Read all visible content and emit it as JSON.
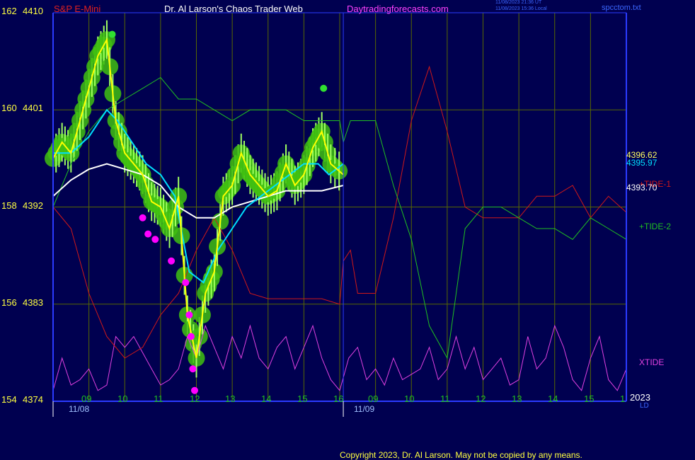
{
  "header": {
    "instrument": "S&P E-Mini",
    "site": "Dr. Al Larson's Chaos Trader Web",
    "url": "Daytradingforecasts.com",
    "stamp_utc": "11/08/2023 21:36 UT",
    "stamp_local": "11/08/2023 15:36 Local",
    "file": "spcctom.txt"
  },
  "footer": {
    "copyright": "Copyright 2023, Dr. Al Larson. May not be copied by any means."
  },
  "colors": {
    "background": "#000050",
    "grid": "#586800",
    "frame": "#2b3bff",
    "price": "#ffff00",
    "fast_ma": "#00e0ff",
    "slow_ma": "#ffffff",
    "tide1": "#d01818",
    "tide2": "#20c020",
    "xtide": "#e040e0",
    "bubbles": "#40c010",
    "bar": "#a0ff60",
    "magenta_dots": "#ff00ff"
  },
  "chart_data": {
    "type": "line",
    "title": "S&P E-Mini",
    "y_price_ticks": [
      4374,
      4383,
      4392,
      4401,
      4410
    ],
    "y_left_ticks": [
      154,
      156,
      158,
      160,
      162
    ],
    "y_range": [
      4374,
      4410
    ],
    "x_hour_ticks": [
      "09",
      "10",
      "11",
      "12",
      "13",
      "14",
      "15",
      "16",
      "09",
      "10",
      "11",
      "12",
      "13",
      "14",
      "15",
      "1"
    ],
    "dates": [
      "11/08",
      "11/09"
    ],
    "x_range": [
      0,
      16
    ],
    "grid": true,
    "year_label": "2023",
    "bottom_right_tag": "LD",
    "labels": {
      "last_price": "4396.62",
      "fast_ma_value": "4395.97",
      "slow_ma_value": "4393.70",
      "tide1": "+TIDE-1",
      "tide2": "+TIDE-2",
      "xtide": "XTIDE"
    },
    "series": [
      {
        "name": "price",
        "x": [
          0,
          0.25,
          0.5,
          0.75,
          1,
          1.25,
          1.5,
          1.75,
          2,
          2.25,
          2.5,
          2.75,
          3,
          3.25,
          3.5,
          3.75,
          4,
          4.25,
          4.5,
          4.75,
          5,
          5.25,
          5.5,
          5.75,
          6,
          6.25,
          6.5,
          6.75,
          7,
          7.25,
          7.5,
          7.75,
          8.1
        ],
        "y": [
          4396.5,
          4398,
          4397,
          4400,
          4403,
          4406,
          4407.5,
          4400,
          4397,
          4396,
          4395,
          4392.5,
          4392,
          4390,
          4393,
          4382,
          4378,
          4384,
          4386,
          4393,
          4394,
          4397,
          4395,
          4394,
          4393,
          4393.5,
          4396,
          4394,
          4395,
          4397.5,
          4399,
          4396,
          4395
        ]
      },
      {
        "name": "fast_ma",
        "x": [
          0,
          0.5,
          1,
          1.5,
          1.8,
          2.2,
          2.6,
          3,
          3.4,
          3.8,
          4.2,
          4.6,
          5,
          5.4,
          5.8,
          6.2,
          6.6,
          7,
          7.4,
          7.7,
          8.1
        ],
        "y": [
          4397,
          4397,
          4398.5,
          4401,
          4400,
          4398,
          4396,
          4395,
          4393,
          4386,
          4385,
          4388,
          4390,
          4392,
          4393,
          4394,
          4395,
          4396,
          4396,
          4395,
          4396
        ]
      },
      {
        "name": "slow_ma",
        "x": [
          0,
          0.5,
          1,
          1.5,
          2,
          2.5,
          3,
          3.5,
          4,
          4.5,
          5,
          5.5,
          6,
          6.5,
          7,
          7.5,
          8.1
        ],
        "y": [
          4393,
          4394.5,
          4395.5,
          4396,
          4395.5,
          4395,
          4394,
          4392,
          4391,
          4391,
          4392,
          4392.5,
          4393,
          4393.5,
          4393.5,
          4393.5,
          4394
        ]
      },
      {
        "name": "TIDE-1",
        "x": [
          0,
          0.5,
          1,
          1.5,
          2,
          2.5,
          3,
          3.5,
          4,
          4.5,
          5,
          5.5,
          6,
          6.5,
          7,
          7.5,
          8,
          8.1,
          8.3,
          8.5,
          9,
          9.5,
          10,
          10.5,
          11,
          11.5,
          12,
          12.5,
          13,
          13.5,
          14,
          14.5,
          15,
          15.5,
          16
        ],
        "y": [
          4392,
          4390,
          4384,
          4380,
          4378,
          4379,
          4382,
          4384,
          4388,
          4391,
          4388,
          4384,
          4383.5,
          4383.5,
          4383.5,
          4383.5,
          4383,
          4387,
          4388,
          4384,
          4384,
          4391,
          4400,
          4405,
          4399,
          4392,
          4391,
          4391,
          4391,
          4393,
          4393,
          4394,
          4391,
          4393,
          4391.5
        ]
      },
      {
        "name": "TIDE-2",
        "x": [
          0,
          0.5,
          1,
          1.5,
          2,
          2.5,
          3,
          3.5,
          4,
          4.5,
          5,
          5.5,
          6,
          6.5,
          7,
          7.5,
          8,
          8.1,
          8.3,
          8.5,
          9,
          9.5,
          10,
          10.5,
          11,
          11.5,
          12,
          12.5,
          13,
          13.5,
          14,
          14.5,
          15,
          15.5,
          16
        ],
        "y": [
          4392,
          4396,
          4399,
          4401,
          4402,
          4403,
          4404,
          4402,
          4402,
          4401,
          4400,
          4401,
          4401,
          4401,
          4400,
          4400,
          4400,
          4398,
          4400,
          4400,
          4400,
          4394,
          4389,
          4381,
          4378,
          4390,
          4392,
          4392,
          4391,
          4390,
          4390,
          4389,
          4391,
          4390,
          4389
        ]
      },
      {
        "name": "XTIDE",
        "x": [
          0,
          0.25,
          0.5,
          0.75,
          1,
          1.25,
          1.5,
          1.75,
          2,
          2.25,
          2.5,
          2.75,
          3,
          3.25,
          3.5,
          3.75,
          4,
          4.25,
          4.5,
          4.75,
          5,
          5.25,
          5.5,
          5.75,
          6,
          6.25,
          6.5,
          6.75,
          7,
          7.25,
          7.5,
          7.75,
          8,
          8.25,
          8.5,
          8.75,
          9,
          9.25,
          9.5,
          9.75,
          10,
          10.25,
          10.5,
          10.75,
          11,
          11.25,
          11.5,
          11.75,
          12,
          12.25,
          12.5,
          12.75,
          13,
          13.25,
          13.5,
          13.75,
          14,
          14.25,
          14.5,
          14.75,
          15,
          15.25,
          15.5,
          15.75,
          16
        ],
        "y": [
          4375,
          4378,
          4375.5,
          4376,
          4377,
          4375,
          4375.5,
          4380,
          4379,
          4380,
          4378.5,
          4377,
          4375.5,
          4376,
          4377,
          4380,
          4378,
          4381,
          4379,
          4377,
          4380,
          4378,
          4381,
          4378,
          4377,
          4379,
          4380,
          4377,
          4379,
          4381,
          4378,
          4376,
          4375,
          4378,
          4379,
          4376,
          4377,
          4375.5,
          4378,
          4376,
          4376.5,
          4377,
          4379,
          4376,
          4377,
          4380,
          4377,
          4379,
          4376,
          4377,
          4378,
          4375.5,
          4376,
          4380,
          4377,
          4378,
          4381,
          4379,
          4376,
          4375,
          4378,
          4380,
          4376,
          4375,
          4377
        ]
      }
    ],
    "magenta_dots": [
      {
        "x": 2.5,
        "y": 4391
      },
      {
        "x": 2.65,
        "y": 4389.5
      },
      {
        "x": 2.85,
        "y": 4389
      },
      {
        "x": 3.3,
        "y": 4387
      },
      {
        "x": 3.7,
        "y": 4385
      },
      {
        "x": 3.8,
        "y": 4382
      },
      {
        "x": 3.85,
        "y": 4380
      },
      {
        "x": 3.9,
        "y": 4377
      },
      {
        "x": 3.95,
        "y": 4375
      }
    ],
    "green_dots": [
      {
        "x": 1.65,
        "y": 4408
      },
      {
        "x": 7.55,
        "y": 4403
      }
    ]
  }
}
